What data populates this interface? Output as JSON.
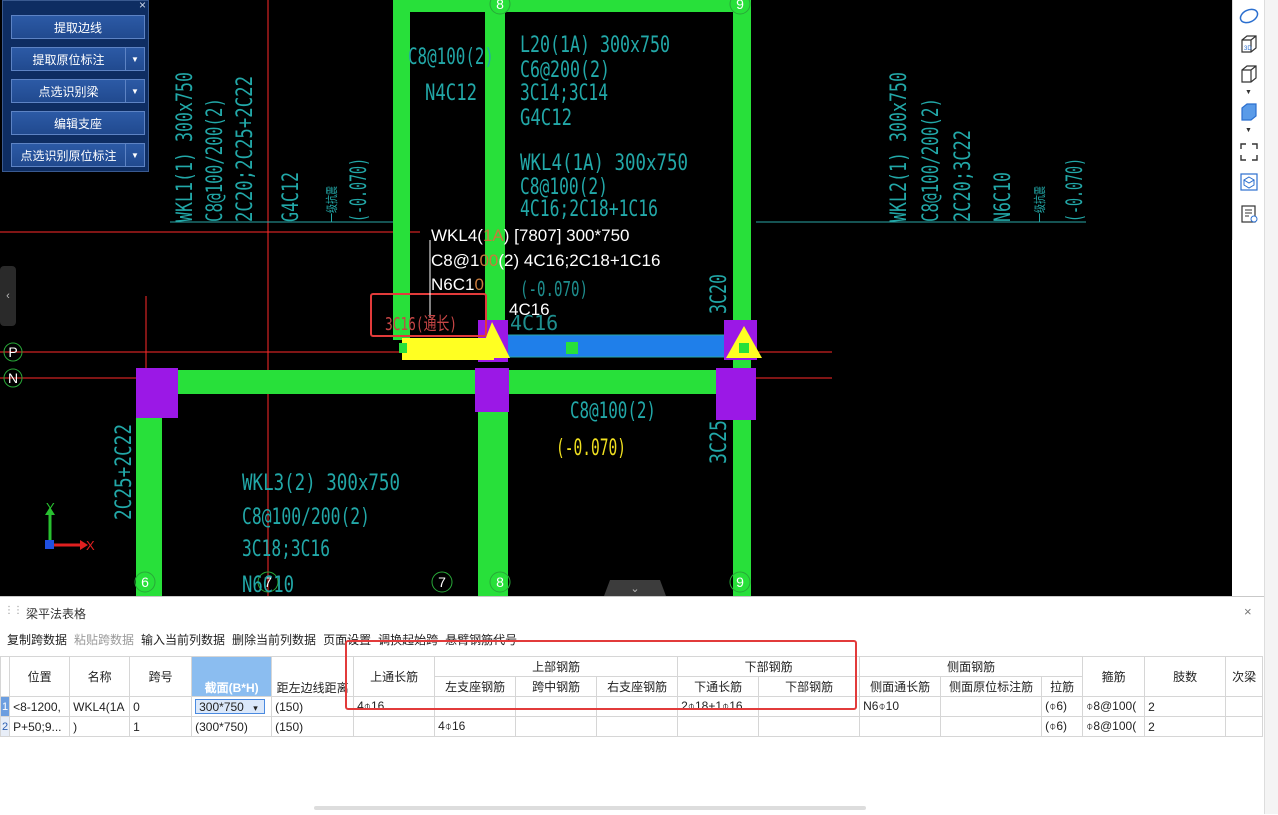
{
  "tool_panel": {
    "buttons": [
      {
        "label": "提取边线",
        "dropdown": false
      },
      {
        "label": "提取原位标注",
        "dropdown": true
      },
      {
        "label": "点选识别梁",
        "dropdown": true
      },
      {
        "label": "编辑支座",
        "dropdown": false
      },
      {
        "label": "点选识别原位标注",
        "dropdown": true
      }
    ],
    "close": "×"
  },
  "cad": {
    "grid_top": [
      "8",
      "9"
    ],
    "grid_bottom": [
      "6",
      "7",
      "7",
      "8",
      "9"
    ],
    "axis_left": [
      "P",
      "N"
    ],
    "axis_right": [
      "P",
      "N"
    ],
    "axis_x": "X",
    "axis_y": "Y",
    "top_cell_text": [
      "C8@100(2)",
      "N4C12"
    ],
    "l20_text": [
      "L20(1A) 300x750",
      "C6@200(2)",
      "3C14;3C14",
      "G4C12"
    ],
    "wkl4_text": [
      "WKL4(1A) 300x750",
      "C8@100(2)",
      "4C16;2C18+1C16"
    ],
    "wkl1_text": [
      "WKL1(1) 300x750",
      "C8@100/200(2)",
      "2C20;2C25+2C22",
      "G4C12",
      "一级抗震",
      "(-0.070)"
    ],
    "wkl2_text": [
      "WKL2(1) 300x750",
      "C8@100/200(2)",
      "2C20;3C22",
      "N6C10",
      "一级抗震",
      "(-0.070)"
    ],
    "popup": {
      "line1_a": "WKL4(",
      "line1_b": "1A",
      "line1_c": ") [7807] 300*750",
      "line2_a": "C8@1",
      "line2_b": "00",
      "line2_c": "(2) 4C16;2C18+1C16",
      "line3_a": "N6C1",
      "line3_b": "0",
      "dim_text": "(-0.070)",
      "rebar_4c16": "4C16",
      "rebar_4c16_faded": "4C16",
      "red_label": "3C16(通长)",
      "col_3c20": "3C20"
    },
    "wkl3_text": [
      "WKL3(2) 300x750",
      "C8@100/200(2)",
      "3C18;3C16",
      "N6C10"
    ],
    "mid_text": [
      "C8@100(2)",
      "(-0.070)"
    ],
    "left_vert": "2C25+2C22",
    "right_vert": "3C25",
    "side_left": "‹",
    "side_right": "›"
  },
  "right_toolbar": {
    "icons": [
      "ellipse-icon",
      "cube-3d-icon",
      "cube-icon",
      "cube-solid-icon",
      "fullscreen-icon",
      "view-icon",
      "settings-list-icon"
    ],
    "label_3d": "3D"
  },
  "bottom": {
    "title": "梁平法表格",
    "toolbar": [
      {
        "label": "复制跨数据",
        "disabled": false
      },
      {
        "label": "粘贴跨数据",
        "disabled": true
      },
      {
        "label": "输入当前列数据",
        "disabled": false
      },
      {
        "label": "删除当前列数据",
        "disabled": false
      },
      {
        "label": "页面设置",
        "disabled": false
      },
      {
        "label": "调换起始跨",
        "disabled": false
      },
      {
        "label": "悬臂钢筋代号",
        "disabled": false
      }
    ],
    "headers": {
      "position": "位置",
      "name": "名称",
      "span": "跨号",
      "section": "截面(B*H)",
      "offset": "距左边线距离",
      "top_through": "上通长筋",
      "top_group": "上部钢筋",
      "left_support": "左支座钢筋",
      "mid_span": "跨中钢筋",
      "right_support": "右支座钢筋",
      "bottom_group": "下部钢筋",
      "bottom_through": "下通长筋",
      "bottom_rebar": "下部钢筋",
      "side_group": "侧面钢筋",
      "side_through": "侧面通长筋",
      "side_orig": "侧面原位标注筋",
      "tie": "拉筋",
      "stirrup": "箍筋",
      "legs": "肢数",
      "secondary": "次梁"
    },
    "rows": [
      {
        "num": "1",
        "position": "<8-1200,",
        "name": "WKL4(1A",
        "span": "0",
        "section": "300*750",
        "offset": "(150)",
        "top_through": "4⌽16",
        "left_support": "",
        "mid_span": "",
        "right_support": "",
        "bottom_through": "2⌽18+1⌽16",
        "bottom_rebar": "",
        "side_through": "N6⌽10",
        "side_orig": "",
        "tie": "(⌽6)",
        "stirrup": "⌽8@100(",
        "legs": "2",
        "secondary": ""
      },
      {
        "num": "2",
        "position": "P+50;9...",
        "name": ")",
        "span": "1",
        "section": "(300*750)",
        "offset": "(150)",
        "top_through": "",
        "left_support": "4⌽16",
        "mid_span": "",
        "right_support": "",
        "bottom_through": "",
        "bottom_rebar": "",
        "side_through": "",
        "side_orig": "",
        "tie": "(⌽6)",
        "stirrup": "⌽8@100(",
        "legs": "2",
        "secondary": ""
      }
    ],
    "dropdown_arrow": "▾",
    "close": "×",
    "collapse": "⌄"
  }
}
